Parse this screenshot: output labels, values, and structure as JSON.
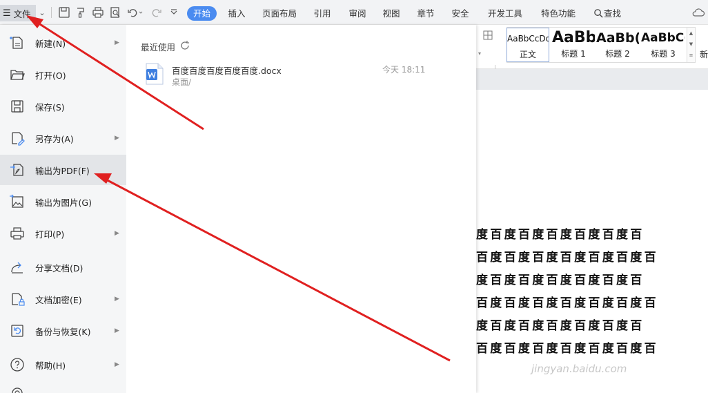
{
  "toolbar": {
    "file_label": "文件",
    "tabs": [
      "开始",
      "插入",
      "页面布局",
      "引用",
      "审阅",
      "视图",
      "章节",
      "安全",
      "开发工具",
      "特色功能"
    ],
    "search_label": "查找"
  },
  "ribbon": {
    "styles": [
      {
        "sample": "AaBbCcDd",
        "label": "正文"
      },
      {
        "sample": "AaBb",
        "label": "标题 1"
      },
      {
        "sample": "AaBb(",
        "label": "标题 2"
      },
      {
        "sample": "AaBbC(",
        "label": "标题 3"
      }
    ],
    "new_style_label": "新"
  },
  "file_menu": {
    "items": [
      {
        "label": "新建(N)",
        "icon": "new-doc-icon",
        "has_arrow": true
      },
      {
        "label": "打开(O)",
        "icon": "folder-open-icon",
        "has_arrow": false
      },
      {
        "label": "保存(S)",
        "icon": "save-icon",
        "has_arrow": false
      },
      {
        "label": "另存为(A)",
        "icon": "save-as-icon",
        "has_arrow": true
      },
      {
        "label": "输出为PDF(F)",
        "icon": "export-pdf-icon",
        "has_arrow": false
      },
      {
        "label": "输出为图片(G)",
        "icon": "export-image-icon",
        "has_arrow": false
      },
      {
        "label": "打印(P)",
        "icon": "printer-icon",
        "has_arrow": true
      },
      {
        "label": "分享文档(D)",
        "icon": "share-icon",
        "has_arrow": false
      },
      {
        "label": "文档加密(E)",
        "icon": "encrypt-doc-icon",
        "has_arrow": true
      },
      {
        "label": "备份与恢复(K)",
        "icon": "backup-restore-icon",
        "has_arrow": true
      },
      {
        "label": "帮助(H)",
        "icon": "help-icon",
        "has_arrow": true
      }
    ],
    "recent": {
      "title": "最近使用",
      "files": [
        {
          "name": "百度百度百度百度百度.docx",
          "path": "桌面/",
          "time": "今天 18:11"
        }
      ]
    }
  },
  "document": {
    "lines": [
      "度百度百度百度百度百度百",
      "百度百度百度百度百度百度百",
      "度百度百度百度百度百度百",
      "百度百度百度百度百度百度百",
      "度百度百度百度百度百度百",
      "百度百度百度百度百度百度百"
    ]
  },
  "watermark": "jingyan.baidu.com",
  "colors": {
    "accent": "#4a8bf0",
    "arrow": "#e02020",
    "hover": "#e3e5e8"
  }
}
